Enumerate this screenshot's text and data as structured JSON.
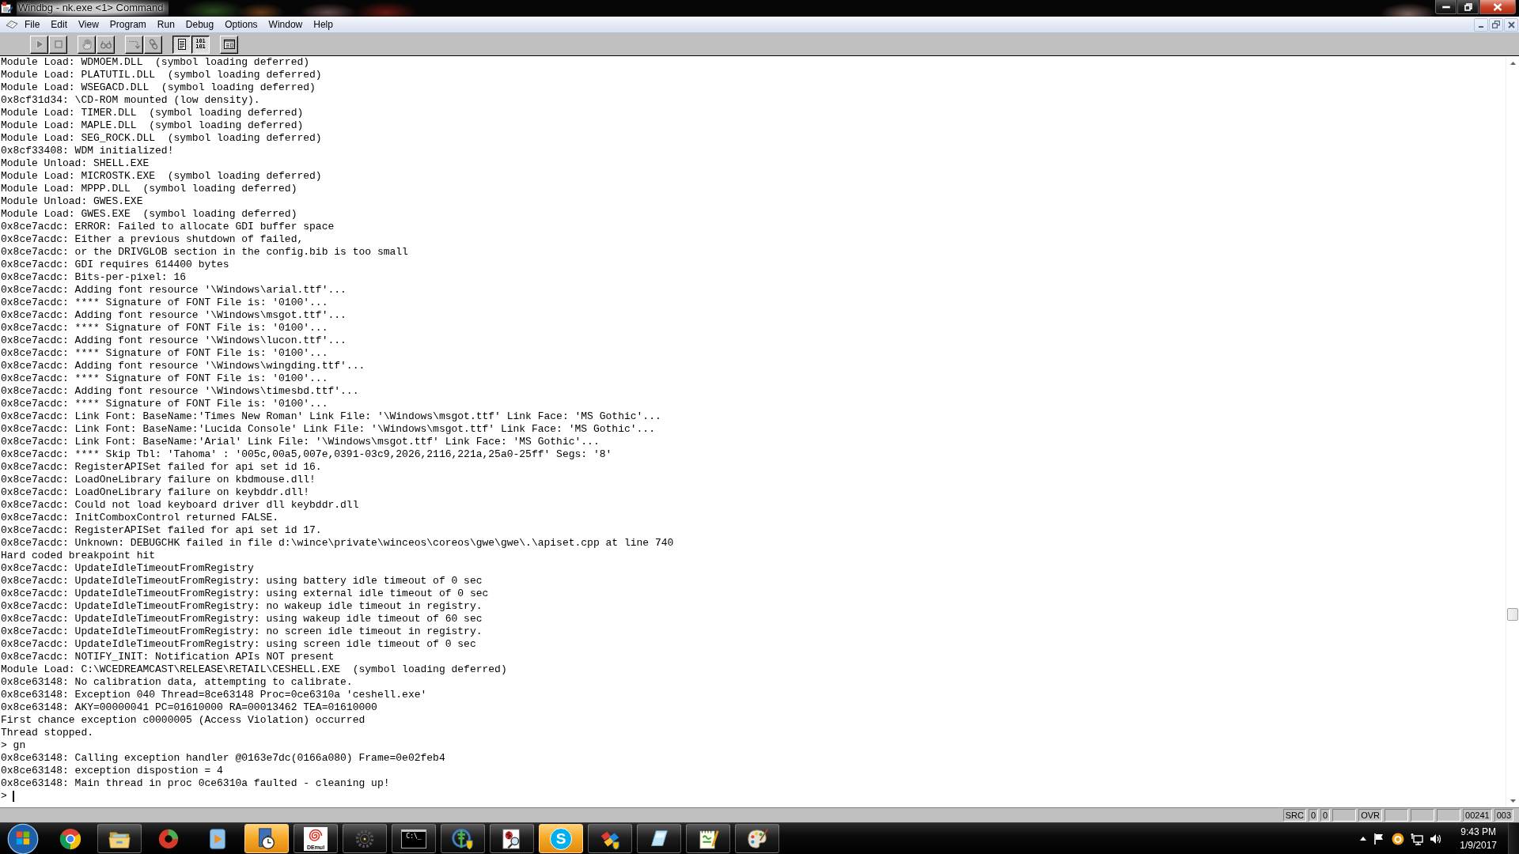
{
  "window": {
    "title": "Windbg - nk.exe <1> Command"
  },
  "menu": [
    "File",
    "Edit",
    "View",
    "Program",
    "Run",
    "Debug",
    "Options",
    "Window",
    "Help"
  ],
  "toolbar": [
    {
      "buttons": [
        {
          "kind": "go",
          "pressed": false
        },
        {
          "kind": "stop",
          "pressed": false
        }
      ]
    },
    {
      "buttons": [
        {
          "kind": "break",
          "pressed": false
        },
        {
          "kind": "watch",
          "pressed": false
        }
      ]
    },
    {
      "buttons": [
        {
          "kind": "step",
          "pressed": false
        },
        {
          "kind": "chain",
          "pressed": false
        }
      ]
    },
    {
      "buttons": [
        {
          "kind": "source",
          "pressed": true
        },
        {
          "kind": "memory",
          "label": "101\n101",
          "pressed": true
        }
      ]
    },
    {
      "buttons": [
        {
          "kind": "window",
          "pressed": false
        }
      ]
    }
  ],
  "command_output": {
    "lines": [
      "Module Load: WDMOEM.DLL  (symbol loading deferred)",
      "Module Load: PLATUTIL.DLL  (symbol loading deferred)",
      "Module Load: WSEGACD.DLL  (symbol loading deferred)",
      "0x8cf31d34: \\CD-ROM mounted (low density).",
      "Module Load: TIMER.DLL  (symbol loading deferred)",
      "Module Load: MAPLE.DLL  (symbol loading deferred)",
      "Module Load: SEG_ROCK.DLL  (symbol loading deferred)",
      "0x8cf33408: WDM initialized!",
      "Module Unload: SHELL.EXE",
      "Module Load: MICROSTK.EXE  (symbol loading deferred)",
      "Module Load: MPPP.DLL  (symbol loading deferred)",
      "Module Unload: GWES.EXE",
      "Module Load: GWES.EXE  (symbol loading deferred)",
      "0x8ce7acdc: ERROR: Failed to allocate GDI buffer space",
      "0x8ce7acdc: Either a previous shutdown of failed,",
      "0x8ce7acdc: or the DRIVGLOB section in the config.bib is too small",
      "0x8ce7acdc: GDI requires 614400 bytes",
      "0x8ce7acdc: Bits-per-pixel: 16",
      "0x8ce7acdc: Adding font resource '\\Windows\\arial.ttf'...",
      "0x8ce7acdc: **** Signature of FONT File is: '0100'...",
      "0x8ce7acdc: Adding font resource '\\Windows\\msgot.ttf'...",
      "0x8ce7acdc: **** Signature of FONT File is: '0100'...",
      "0x8ce7acdc: Adding font resource '\\Windows\\lucon.ttf'...",
      "0x8ce7acdc: **** Signature of FONT File is: '0100'...",
      "0x8ce7acdc: Adding font resource '\\Windows\\wingding.ttf'...",
      "0x8ce7acdc: **** Signature of FONT File is: '0100'...",
      "0x8ce7acdc: Adding font resource '\\Windows\\timesbd.ttf'...",
      "0x8ce7acdc: **** Signature of FONT File is: '0100'...",
      "0x8ce7acdc: Link Font: BaseName:'Times New Roman' Link File: '\\Windows\\msgot.ttf' Link Face: 'MS Gothic'...",
      "0x8ce7acdc: Link Font: BaseName:'Lucida Console' Link File: '\\Windows\\msgot.ttf' Link Face: 'MS Gothic'...",
      "0x8ce7acdc: Link Font: BaseName:'Arial' Link File: '\\Windows\\msgot.ttf' Link Face: 'MS Gothic'...",
      "0x8ce7acdc: **** Skip Tbl: 'Tahoma' : '005c,00a5,007e,0391-03c9,2026,2116,221a,25a0-25ff' Segs: '8'",
      "0x8ce7acdc: RegisterAPISet failed for api set id 16.",
      "0x8ce7acdc: LoadOneLibrary failure on kbdmouse.dll!",
      "0x8ce7acdc: LoadOneLibrary failure on keybddr.dll!",
      "0x8ce7acdc: Could not load keyboard driver dll keybddr.dll",
      "0x8ce7acdc: InitComboxControl returned FALSE.",
      "0x8ce7acdc: RegisterAPISet failed for api set id 17.",
      "0x8ce7acdc: Unknown: DEBUGCHK failed in file d:\\wince\\private\\winceos\\coreos\\gwe\\gwe\\.\\apiset.cpp at line 740",
      "Hard coded breakpoint hit",
      "0x8ce7acdc: UpdateIdleTimeoutFromRegistry",
      "0x8ce7acdc: UpdateIdleTimeoutFromRegistry: using battery idle timeout of 0 sec",
      "0x8ce7acdc: UpdateIdleTimeoutFromRegistry: using external idle timeout of 0 sec",
      "0x8ce7acdc: UpdateIdleTimeoutFromRegistry: no wakeup idle timeout in registry.",
      "0x8ce7acdc: UpdateIdleTimeoutFromRegistry: using wakeup idle timeout of 60 sec",
      "0x8ce7acdc: UpdateIdleTimeoutFromRegistry: no screen idle timeout in registry.",
      "0x8ce7acdc: UpdateIdleTimeoutFromRegistry: using screen idle timeout of 0 sec",
      "0x8ce7acdc: NOTIFY_INIT: Notification APIs NOT present",
      "Module Load: C:\\WCEDREAMCAST\\RELEASE\\RETAIL\\CESHELL.EXE  (symbol loading deferred)",
      "0x8ce63148: No calibration data, attempting to calibrate.",
      "0x8ce63148: Exception 040 Thread=8ce63148 Proc=0ce6310a 'ceshell.exe'",
      "0x8ce63148: AKY=00000041 PC=01610000 RA=00013462 TEA=01610000",
      "First chance exception c0000005 (Access Violation) occurred",
      "Thread stopped.",
      "> gn",
      "0x8ce63148: Calling exception handler @0163e7dc(0166a080) Frame=0e02feb4",
      "0x8ce63148: exception dispostion = 4",
      "0x8ce63148: Main thread in proc 0ce6310a faulted - cleaning up!"
    ],
    "prompt": ">"
  },
  "status_bar": {
    "panels": [
      {
        "kind": "text",
        "text": "SRC"
      },
      {
        "kind": "text",
        "text": "0"
      },
      {
        "kind": "text",
        "text": "0"
      },
      {
        "kind": "blank"
      },
      {
        "kind": "text",
        "text": "OVR"
      },
      {
        "kind": "blank"
      },
      {
        "kind": "blank"
      },
      {
        "kind": "blank"
      },
      {
        "kind": "text",
        "text": "00241"
      },
      {
        "kind": "text",
        "text": "003"
      }
    ]
  },
  "taskbar": {
    "apps": [
      {
        "kind": "browser",
        "running": false,
        "flashing": false
      },
      {
        "kind": "folder",
        "running": true,
        "flashing": false
      },
      {
        "kind": "crescent",
        "running": false,
        "flashing": false
      },
      {
        "kind": "media",
        "running": false,
        "flashing": false
      },
      {
        "kind": "stopwatch",
        "running": true,
        "flashing": true
      },
      {
        "kind": "spiral",
        "label": "DEmul",
        "running": true,
        "flashing": false
      },
      {
        "kind": "gear",
        "running": true,
        "flashing": false
      },
      {
        "kind": "terminal",
        "label": "C:\\_",
        "running": true,
        "flashing": false
      },
      {
        "kind": "tower",
        "running": true,
        "flashing": false
      },
      {
        "kind": "bug",
        "running": true,
        "flashing": false
      },
      {
        "kind": "chat",
        "label": "S",
        "running": true,
        "flashing": true
      },
      {
        "kind": "blocks",
        "running": true,
        "flashing": false
      },
      {
        "kind": "notepad",
        "running": true,
        "flashing": false
      },
      {
        "kind": "notepad_pencil",
        "running": true,
        "flashing": false
      },
      {
        "kind": "palette",
        "running": true,
        "flashing": false
      }
    ],
    "clock": {
      "time": "9:43 PM",
      "date": "1/9/2017"
    }
  }
}
